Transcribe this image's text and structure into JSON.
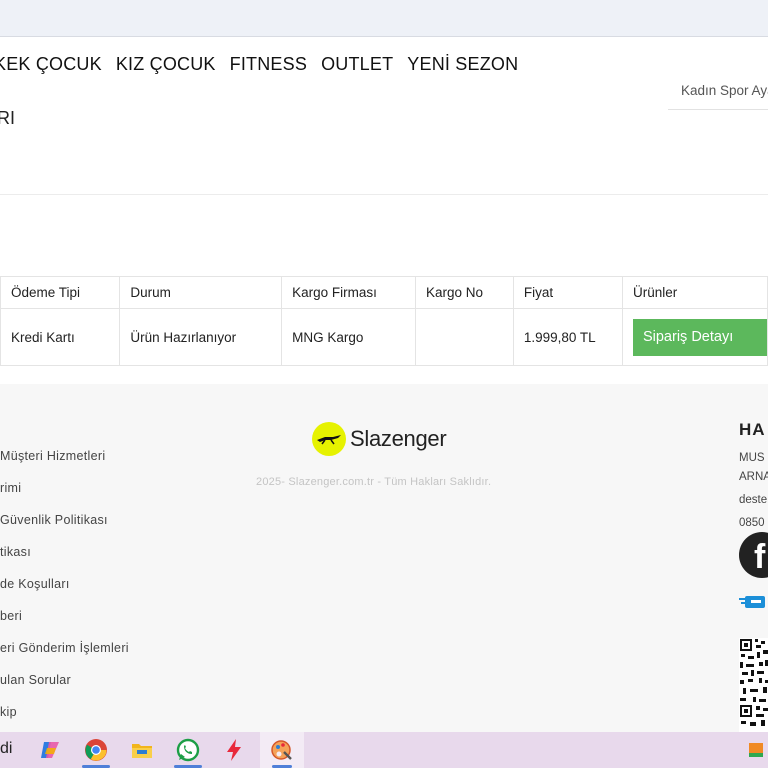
{
  "nav": {
    "items": [
      "KEK ÇOCUK",
      "KIZ ÇOCUK",
      "FITNESS",
      "OUTLET",
      "YENİ SEZON"
    ]
  },
  "search": {
    "placeholder": "Kadın Spor Ayakkabı"
  },
  "sub_fragment": "RI",
  "orders_table": {
    "headers": [
      "Ödeme Tipi",
      "Durum",
      "Kargo Firması",
      "Kargo No",
      "Fiyat",
      "Ürünler"
    ],
    "rows": [
      {
        "payment": "Kredi Kartı",
        "status": "Ürün Hazırlanıyor",
        "carrier": "MNG Kargo",
        "tracking": "",
        "price": "1.999,80 TL",
        "action": "Sipariş Detayı"
      }
    ]
  },
  "footer": {
    "links": [
      "Müşteri Hizmetleri",
      "rimi",
      "Güvenlik Politikası",
      "tikası",
      "de Koşulları",
      "beri",
      "eri Gönderim İşlemleri",
      "ulan Sorular",
      "kip"
    ],
    "brand": "Slazenger",
    "copyright": "2025- Slazenger.com.tr - Tüm Hakları Saklıdır.",
    "contact": {
      "heading": "HA",
      "lines": [
        "MUS",
        "ARNA",
        "deste",
        "0850"
      ]
    },
    "facebook_letter": "f"
  },
  "taskbar": {
    "left_fragment": "di",
    "icons": [
      "copilot-icon",
      "chrome-icon",
      "file-explorer-icon",
      "whatsapp-icon",
      "flash-app-icon",
      "paint-app-icon"
    ]
  },
  "colors": {
    "button_green": "#5cb85c",
    "brand_yellow": "#e6f200",
    "footer_bg": "#f7f7f7",
    "taskbar_bg": "#e8d9ec"
  }
}
